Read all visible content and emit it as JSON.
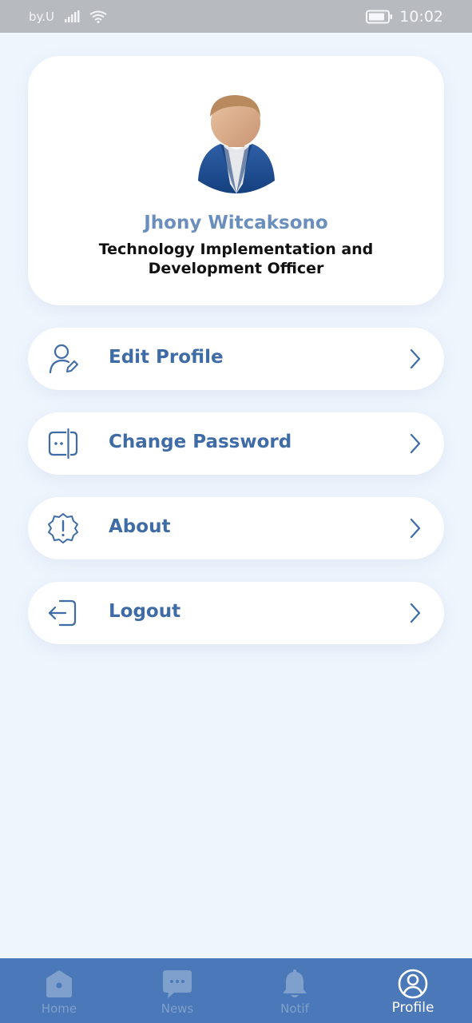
{
  "status_bar": {
    "carrier": "by.U",
    "time": "10:02",
    "icons": [
      "signal-icon",
      "wifi-icon",
      "battery-icon"
    ]
  },
  "profile": {
    "name": "Jhony Witcaksono",
    "job_title": "Technology Implementation and Development Officer",
    "avatar_icon": "person-avatar"
  },
  "menu": {
    "items": [
      {
        "label": "Edit Profile",
        "icon": "user-edit-icon"
      },
      {
        "label": "Change Password",
        "icon": "password-icon"
      },
      {
        "label": "About",
        "icon": "info-badge-icon"
      },
      {
        "label": "Logout",
        "icon": "logout-icon"
      }
    ]
  },
  "bottom_nav": {
    "items": [
      {
        "label": "Home",
        "icon": "home-icon",
        "active": false
      },
      {
        "label": "News",
        "icon": "chat-icon",
        "active": false
      },
      {
        "label": "Notif",
        "icon": "bell-icon",
        "active": false
      },
      {
        "label": "Profile",
        "icon": "profile-icon",
        "active": true
      }
    ]
  },
  "colors": {
    "background": "#eef5fd",
    "accent": "#3f6ca6",
    "name": "#6b8fbd",
    "nav_background": "#4a78b8",
    "nav_inactive": "#7fa0cc",
    "nav_active": "#ffffff",
    "status_bar": "#b7bbc0"
  }
}
